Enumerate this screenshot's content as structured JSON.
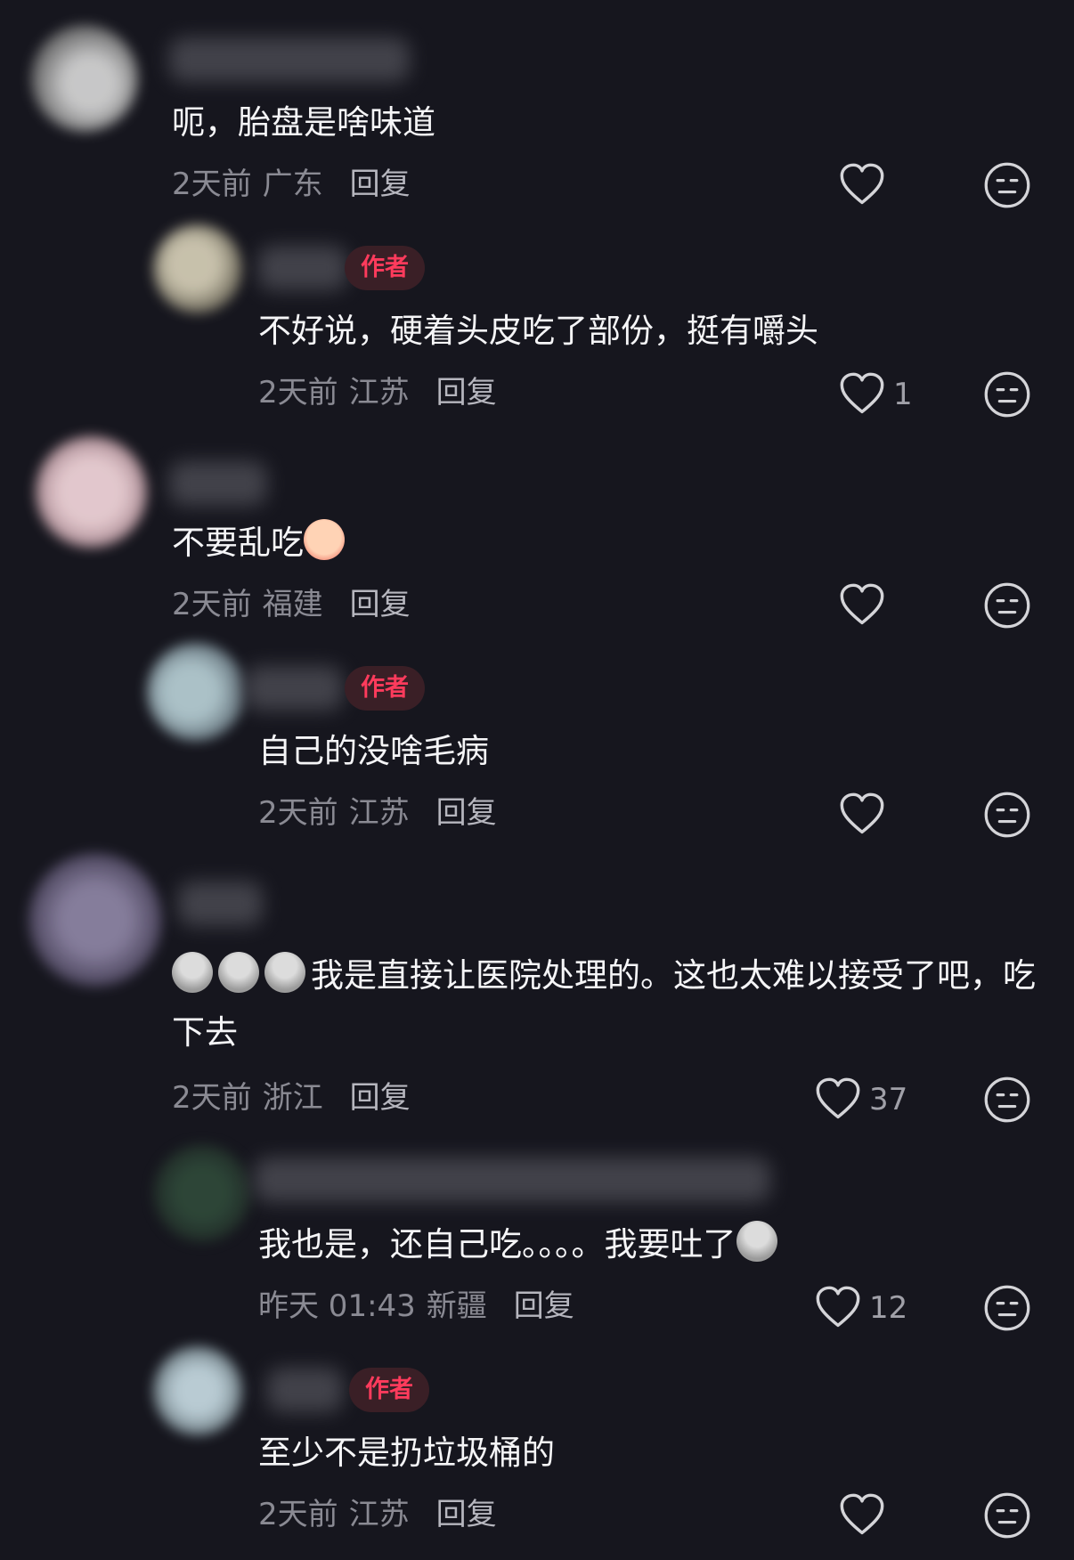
{
  "comments": [
    {
      "text": "呃，胎盘是啥味道",
      "time": "2天前",
      "location": "广东",
      "reply": "回复",
      "likes": ""
    },
    {
      "badge": "作者",
      "text": "不好说，硬着头皮吃了部份，挺有嚼头",
      "time": "2天前",
      "location": "江苏",
      "reply": "回复",
      "likes": "1"
    },
    {
      "text": "不要乱吃",
      "emoji_icon": "crying-face-emoji",
      "time": "2天前",
      "location": "福建",
      "reply": "回复",
      "likes": ""
    },
    {
      "badge": "作者",
      "text": "自己的没啥毛病",
      "time": "2天前",
      "location": "江苏",
      "reply": "回复",
      "likes": ""
    },
    {
      "text": "我是直接让医院处理的。这也太难以接受了吧，吃下去",
      "emoji_icon": "ghost-face-emoji",
      "time": "2天前",
      "location": "浙江",
      "reply": "回复",
      "likes": "37"
    },
    {
      "text": "我也是，还自己吃。。。。我要吐了",
      "emoji_icon": "ghost-face-emoji",
      "time": "昨天 01:43",
      "location": "新疆",
      "reply": "回复",
      "likes": "12"
    },
    {
      "badge": "作者",
      "text": "至少不是扔垃圾桶的",
      "time": "2天前",
      "location": "江苏",
      "reply": "回复",
      "likes": ""
    }
  ],
  "icons": {
    "like": "heart-icon",
    "dislike": "meh-face-icon"
  },
  "colors": {
    "background": "#16161e",
    "author_badge": "#ff3b5c",
    "secondary_text": "#8a8a93"
  }
}
